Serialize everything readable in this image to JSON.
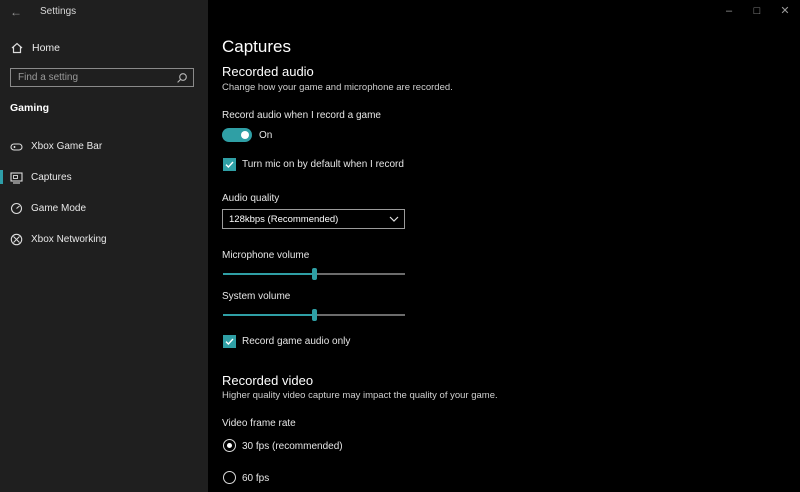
{
  "window": {
    "title": "Settings"
  },
  "sidebar": {
    "home_label": "Home",
    "search_placeholder": "Find a setting",
    "section_title": "Gaming",
    "items": [
      {
        "label": "Xbox Game Bar",
        "icon": "xbox-game-bar-icon",
        "selected": false
      },
      {
        "label": "Captures",
        "icon": "captures-icon",
        "selected": true
      },
      {
        "label": "Game Mode",
        "icon": "game-mode-icon",
        "selected": false
      },
      {
        "label": "Xbox Networking",
        "icon": "xbox-networking-icon",
        "selected": false
      }
    ]
  },
  "main": {
    "title": "Captures",
    "recorded_audio": {
      "heading": "Recorded audio",
      "description": "Change how your game and microphone are recorded.",
      "record_audio_label": "Record audio when I record a game",
      "record_audio_state": "On",
      "mic_default_label": "Turn mic on by default when I record",
      "mic_default_checked": true,
      "audio_quality_label": "Audio quality",
      "audio_quality_value": "128kbps (Recommended)",
      "microphone_volume_label": "Microphone volume",
      "microphone_volume": 50,
      "system_volume_label": "System volume",
      "system_volume": 50,
      "game_audio_only_label": "Record game audio only",
      "game_audio_only_checked": true
    },
    "recorded_video": {
      "heading": "Recorded video",
      "description": "Higher quality video capture may impact the quality of your game.",
      "frame_rate_label": "Video frame rate",
      "options": [
        {
          "label": "30 fps (recommended)",
          "selected": true
        },
        {
          "label": "60 fps",
          "selected": false
        }
      ]
    }
  },
  "colors": {
    "accent": "#2f9fa5",
    "sidebar_bg": "#1f1f1f",
    "main_bg": "#000000"
  }
}
